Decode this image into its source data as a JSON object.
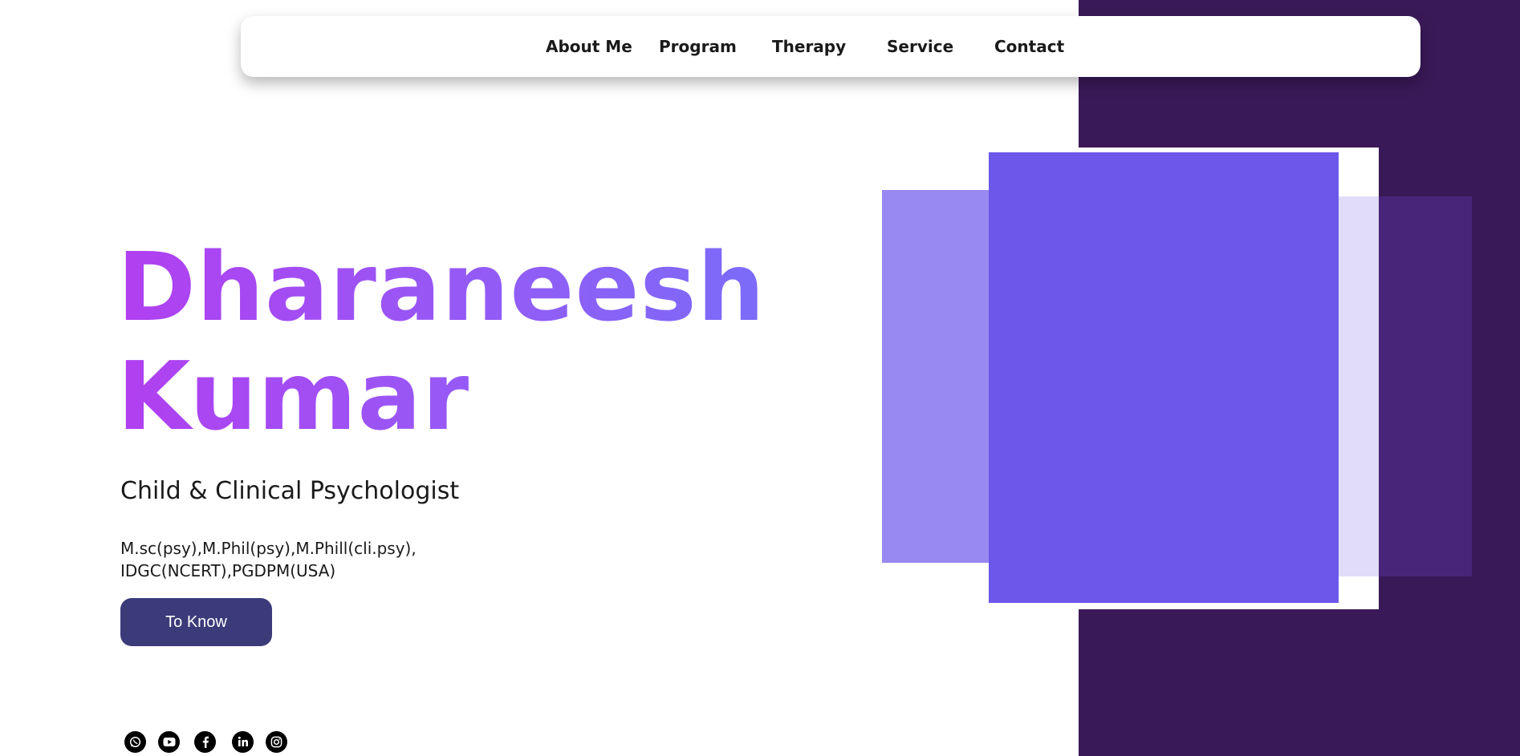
{
  "nav": {
    "items": [
      {
        "label": "About Me"
      },
      {
        "label": "Program"
      },
      {
        "label": "Therapy"
      },
      {
        "label": "Service"
      },
      {
        "label": "Contact"
      }
    ]
  },
  "hero": {
    "first_name": "Dharaneesh",
    "last_name": "Kumar",
    "subtitle": "Child & Clinical Psychologist",
    "qualifications_line1": "M.sc(psy),M.Phil(psy),M.Phill(cli.psy),",
    "qualifications_line2": "IDGC(NCERT),PGDPM(USA)",
    "button_label": "To Know",
    "name_gradient": [
      "#b13ff0",
      "#7b6cf8"
    ]
  },
  "social": {
    "icons": [
      "whatsapp-icon",
      "youtube-icon",
      "facebook-icon",
      "linkedin-icon",
      "instagram-icon"
    ]
  },
  "colors": {
    "panel": "#3a1958",
    "accent_main": "#6c57ea",
    "accent_light": "#9888f1",
    "button": "#3c3b7a"
  }
}
